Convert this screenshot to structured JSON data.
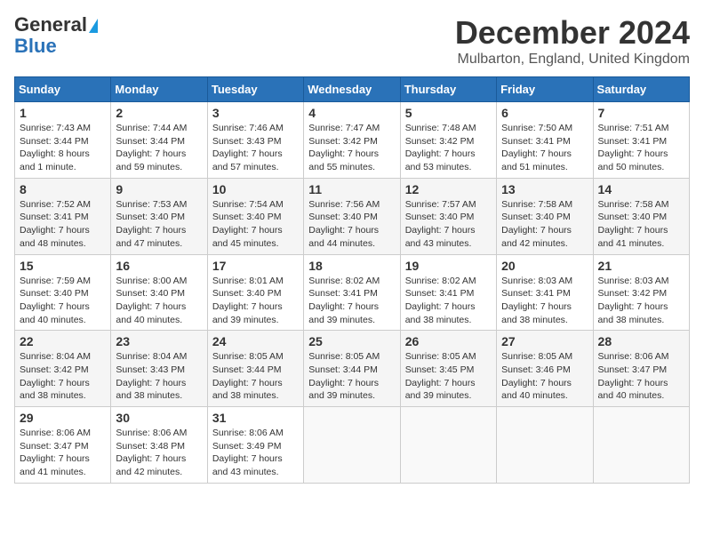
{
  "logo": {
    "line1": "General",
    "line2": "Blue"
  },
  "header": {
    "month": "December 2024",
    "location": "Mulbarton, England, United Kingdom"
  },
  "weekdays": [
    "Sunday",
    "Monday",
    "Tuesday",
    "Wednesday",
    "Thursday",
    "Friday",
    "Saturday"
  ],
  "weeks": [
    [
      {
        "day": "1",
        "info": "Sunrise: 7:43 AM\nSunset: 3:44 PM\nDaylight: 8 hours and 1 minute."
      },
      {
        "day": "2",
        "info": "Sunrise: 7:44 AM\nSunset: 3:44 PM\nDaylight: 7 hours and 59 minutes."
      },
      {
        "day": "3",
        "info": "Sunrise: 7:46 AM\nSunset: 3:43 PM\nDaylight: 7 hours and 57 minutes."
      },
      {
        "day": "4",
        "info": "Sunrise: 7:47 AM\nSunset: 3:42 PM\nDaylight: 7 hours and 55 minutes."
      },
      {
        "day": "5",
        "info": "Sunrise: 7:48 AM\nSunset: 3:42 PM\nDaylight: 7 hours and 53 minutes."
      },
      {
        "day": "6",
        "info": "Sunrise: 7:50 AM\nSunset: 3:41 PM\nDaylight: 7 hours and 51 minutes."
      },
      {
        "day": "7",
        "info": "Sunrise: 7:51 AM\nSunset: 3:41 PM\nDaylight: 7 hours and 50 minutes."
      }
    ],
    [
      {
        "day": "8",
        "info": "Sunrise: 7:52 AM\nSunset: 3:41 PM\nDaylight: 7 hours and 48 minutes."
      },
      {
        "day": "9",
        "info": "Sunrise: 7:53 AM\nSunset: 3:40 PM\nDaylight: 7 hours and 47 minutes."
      },
      {
        "day": "10",
        "info": "Sunrise: 7:54 AM\nSunset: 3:40 PM\nDaylight: 7 hours and 45 minutes."
      },
      {
        "day": "11",
        "info": "Sunrise: 7:56 AM\nSunset: 3:40 PM\nDaylight: 7 hours and 44 minutes."
      },
      {
        "day": "12",
        "info": "Sunrise: 7:57 AM\nSunset: 3:40 PM\nDaylight: 7 hours and 43 minutes."
      },
      {
        "day": "13",
        "info": "Sunrise: 7:58 AM\nSunset: 3:40 PM\nDaylight: 7 hours and 42 minutes."
      },
      {
        "day": "14",
        "info": "Sunrise: 7:58 AM\nSunset: 3:40 PM\nDaylight: 7 hours and 41 minutes."
      }
    ],
    [
      {
        "day": "15",
        "info": "Sunrise: 7:59 AM\nSunset: 3:40 PM\nDaylight: 7 hours and 40 minutes."
      },
      {
        "day": "16",
        "info": "Sunrise: 8:00 AM\nSunset: 3:40 PM\nDaylight: 7 hours and 40 minutes."
      },
      {
        "day": "17",
        "info": "Sunrise: 8:01 AM\nSunset: 3:40 PM\nDaylight: 7 hours and 39 minutes."
      },
      {
        "day": "18",
        "info": "Sunrise: 8:02 AM\nSunset: 3:41 PM\nDaylight: 7 hours and 39 minutes."
      },
      {
        "day": "19",
        "info": "Sunrise: 8:02 AM\nSunset: 3:41 PM\nDaylight: 7 hours and 38 minutes."
      },
      {
        "day": "20",
        "info": "Sunrise: 8:03 AM\nSunset: 3:41 PM\nDaylight: 7 hours and 38 minutes."
      },
      {
        "day": "21",
        "info": "Sunrise: 8:03 AM\nSunset: 3:42 PM\nDaylight: 7 hours and 38 minutes."
      }
    ],
    [
      {
        "day": "22",
        "info": "Sunrise: 8:04 AM\nSunset: 3:42 PM\nDaylight: 7 hours and 38 minutes."
      },
      {
        "day": "23",
        "info": "Sunrise: 8:04 AM\nSunset: 3:43 PM\nDaylight: 7 hours and 38 minutes."
      },
      {
        "day": "24",
        "info": "Sunrise: 8:05 AM\nSunset: 3:44 PM\nDaylight: 7 hours and 38 minutes."
      },
      {
        "day": "25",
        "info": "Sunrise: 8:05 AM\nSunset: 3:44 PM\nDaylight: 7 hours and 39 minutes."
      },
      {
        "day": "26",
        "info": "Sunrise: 8:05 AM\nSunset: 3:45 PM\nDaylight: 7 hours and 39 minutes."
      },
      {
        "day": "27",
        "info": "Sunrise: 8:05 AM\nSunset: 3:46 PM\nDaylight: 7 hours and 40 minutes."
      },
      {
        "day": "28",
        "info": "Sunrise: 8:06 AM\nSunset: 3:47 PM\nDaylight: 7 hours and 40 minutes."
      }
    ],
    [
      {
        "day": "29",
        "info": "Sunrise: 8:06 AM\nSunset: 3:47 PM\nDaylight: 7 hours and 41 minutes."
      },
      {
        "day": "30",
        "info": "Sunrise: 8:06 AM\nSunset: 3:48 PM\nDaylight: 7 hours and 42 minutes."
      },
      {
        "day": "31",
        "info": "Sunrise: 8:06 AM\nSunset: 3:49 PM\nDaylight: 7 hours and 43 minutes."
      },
      null,
      null,
      null,
      null
    ]
  ]
}
